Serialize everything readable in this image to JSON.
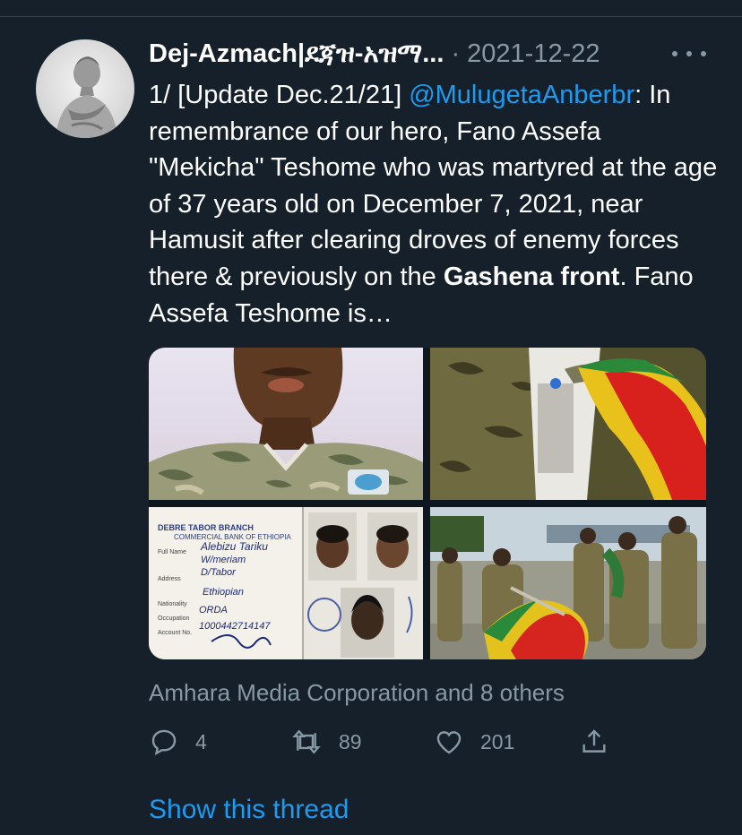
{
  "tweet": {
    "author_name": "Dej-Azmach|ደጃዝ-አዝማ...",
    "separator": " · ",
    "date": "2021-12-22",
    "text_prefix": "1/ [Update Dec.21/21] ",
    "mention": "@MulugetaAnberbr",
    "text_main": ": In remembrance of our hero, Fano Assefa \"Mekicha\" Teshome who was martyred at the age of 37 years old on December 7, 2021, near Hamusit after clearing droves of enemy forces there & previously on the ",
    "text_bold": "Gashena front",
    "text_end": ". Fano Assefa Teshome is…",
    "attribution": "Amhara Media Corporation and 8 others",
    "show_thread": "Show this thread"
  },
  "stats": {
    "replies": "4",
    "retweets": "89",
    "likes": "201"
  },
  "media": {
    "id_card_labels": {
      "bank": "COMMERCIAL BANK OF ETHIOPIA",
      "branch": "DEBRE TABOR BRANCH",
      "full_name_label": "Full Name",
      "full_name": "Alebizu Tariku",
      "full_name_2": "W/meriam",
      "address_label": "Address",
      "address": "D/Tabor",
      "nationality_label": "Nationality",
      "nationality": "Ethiopian",
      "occupation_label": "Occupation",
      "occupation": "ORDA",
      "account_label": "Account No.",
      "account": "1000442714147"
    }
  },
  "colors": {
    "background": "#15202b",
    "accent": "#1d9bf0",
    "muted": "#8899a6"
  },
  "icons": [
    "more-icon",
    "reply-icon",
    "retweet-icon",
    "like-icon",
    "share-icon"
  ]
}
